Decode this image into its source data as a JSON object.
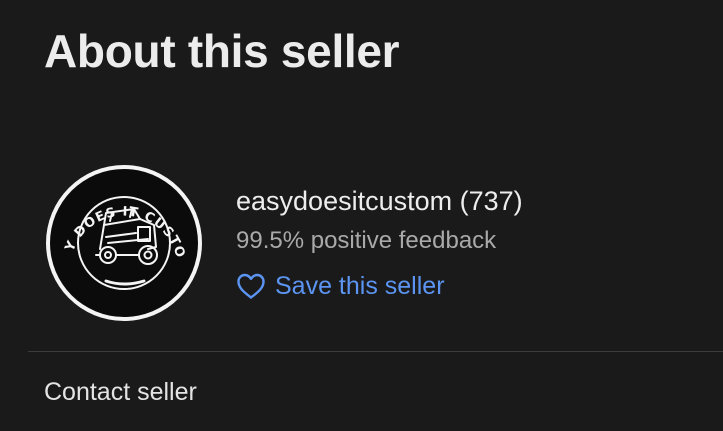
{
  "section": {
    "title": "About this seller"
  },
  "seller": {
    "logo": {
      "icon": "easy-does-it-customs-logo",
      "text": "EASY DOES IT CUSTOMS"
    },
    "name_with_count": "easydoesitcustom (737)",
    "feedback": "99.5% positive feedback",
    "save_label": "Save this seller",
    "save_icon": "heart-outline-icon"
  },
  "contact": {
    "label": "Contact seller"
  },
  "colors": {
    "background": "#1a1a1a",
    "text_primary": "#ececec",
    "text_secondary": "#a9a9a9",
    "link": "#5b94f1",
    "divider": "#3c3c3c"
  }
}
